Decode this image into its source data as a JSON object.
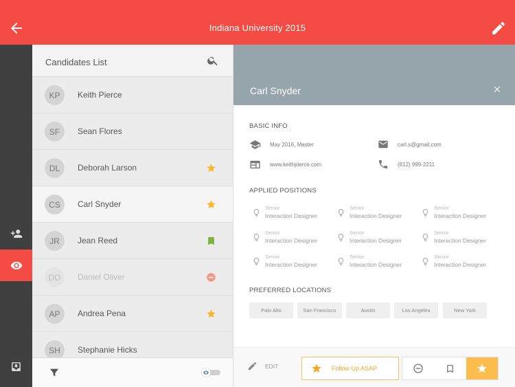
{
  "header": {
    "title": "Indiana University 2015",
    "back_icon": "arrow-back-icon",
    "edit_icon": "pencil-icon",
    "color": "#f44c44"
  },
  "rail": {
    "items": [
      "add-person-icon",
      "eye-icon",
      "inbox-icon"
    ],
    "active": "eye-icon"
  },
  "list": {
    "title": "Candidates List",
    "candidates": [
      {
        "initials": "KP",
        "name": "Keith Pierce",
        "status": ""
      },
      {
        "initials": "SF",
        "name": "Sean Flores",
        "status": ""
      },
      {
        "initials": "DL",
        "name": "Deborah Larson",
        "status": "star"
      },
      {
        "initials": "CS",
        "name": "Carl Snyder",
        "status": "star"
      },
      {
        "initials": "JR",
        "name": "Jean Reed",
        "status": "bookmark"
      },
      {
        "initials": "DO",
        "name": "Daniel Oliver",
        "status": "rejected"
      },
      {
        "initials": "AP",
        "name": "Andrea Pena",
        "status": "star"
      },
      {
        "initials": "SH",
        "name": "Stephanie Hicks",
        "status": ""
      }
    ],
    "selected": "Carl Snyder"
  },
  "detail": {
    "name": "Carl Snyder",
    "basic_info_title": "BASIC INFO",
    "education": "May 2016, Master",
    "email": "carl.s@gmail.com",
    "website": "www.keithpierce.com",
    "phone": "(812) 999-2211",
    "applied_title": "APPLIED POSITIONS",
    "positions": [
      {
        "level": "Senior",
        "role": "Interaction Designer"
      },
      {
        "level": "Senior",
        "role": "Interaction Designer"
      },
      {
        "level": "Senior",
        "role": "Interaction Designer"
      },
      {
        "level": "Senior",
        "role": "Interaction Designer"
      },
      {
        "level": "Senior",
        "role": "Interaction Designer"
      },
      {
        "level": "Senior",
        "role": "Interaction Designer"
      },
      {
        "level": "Senior",
        "role": "Interaction Designer"
      },
      {
        "level": "Senior",
        "role": "Interaction Designer"
      },
      {
        "level": "Senior",
        "role": "Interaction Designer"
      }
    ],
    "locations_title": "PREFERRED LOCATIONS",
    "locations": [
      "Palo Alto",
      "San Francisco",
      "Austin",
      "Los Angeles",
      "New York"
    ],
    "edit_label": "EDIT",
    "follow_label": "Follow Up ASAP",
    "accent": "#f5a623"
  }
}
